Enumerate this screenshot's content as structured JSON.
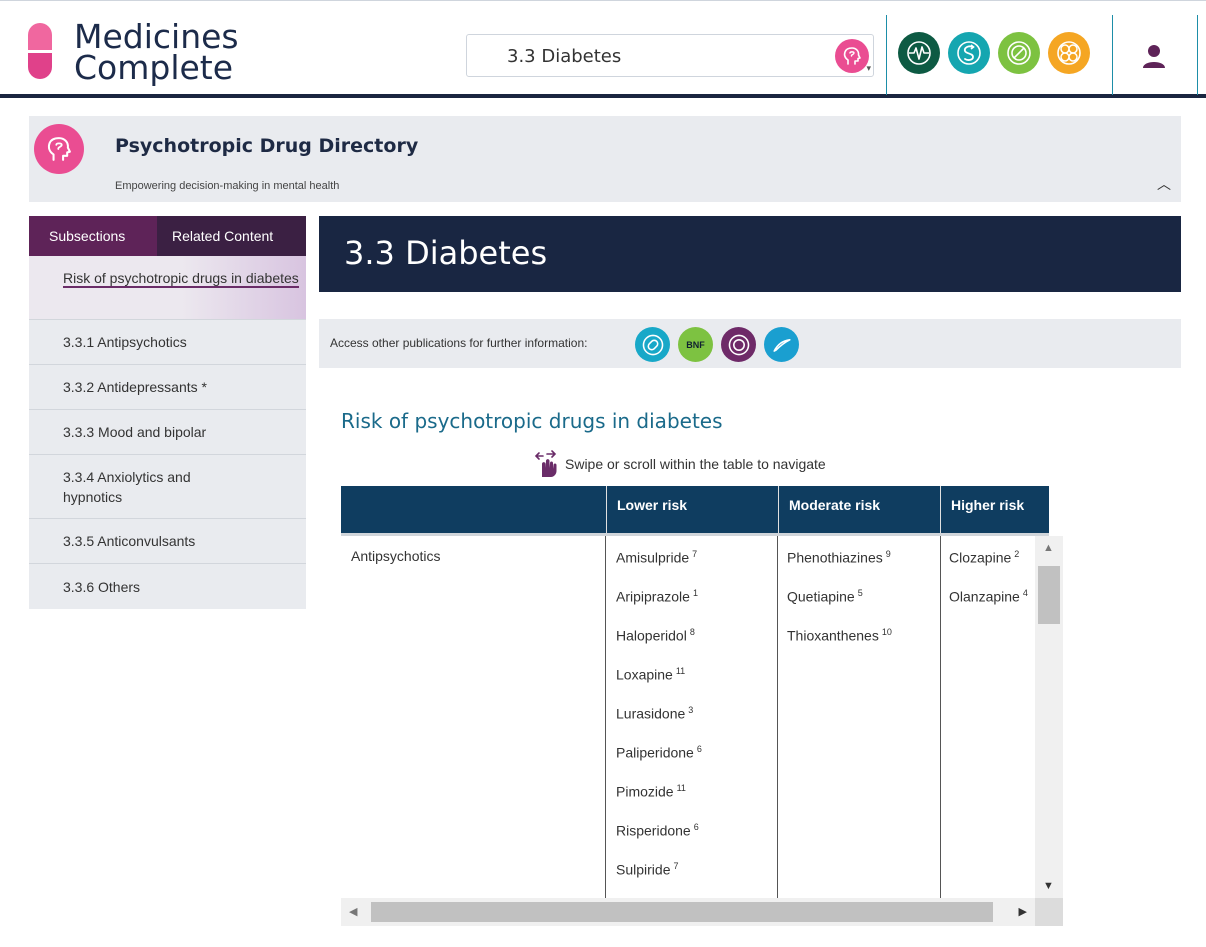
{
  "header": {
    "brand_line1": "Medicines",
    "brand_line2": "Complete",
    "search_value": "3.3 Diabetes",
    "publication_icons": [
      "pulse-icon",
      "cycle-icon",
      "pill-icon",
      "molecule-icon"
    ],
    "accent_colors": {
      "pink": "#ea4d92",
      "green": "#0d5a43",
      "teal": "#15a6b0",
      "lime": "#7dc241",
      "orange": "#f5a623",
      "navy": "#192642",
      "purple": "#5e2358"
    }
  },
  "banner": {
    "title": "Psychotropic Drug Directory",
    "subtitle": "Empowering decision-making in mental health"
  },
  "sidebar": {
    "tabs": [
      "Subsections",
      "Related Content"
    ],
    "items": [
      {
        "label": "Risk of psychotropic drugs in diabetes"
      },
      {
        "label": "3.3.1 Antipsychotics"
      },
      {
        "label": "3.3.2 Antidepressants *"
      },
      {
        "label": "3.3.3 Mood and bipolar"
      },
      {
        "label": "3.3.4 Anxiolytics and hypnotics"
      },
      {
        "label": "3.3.5 Anticonvulsants"
      },
      {
        "label": "3.3.6 Others"
      }
    ]
  },
  "main": {
    "title": "3.3 Diabetes",
    "access_label": "Access other publications for further information:",
    "access_bnf": "BNF",
    "section_heading": "Risk of psychotropic drugs in diabetes",
    "swipe_hint": "Swipe or scroll within the table to navigate"
  },
  "table": {
    "headers": [
      "",
      "Lower risk",
      "Moderate risk",
      "Higher risk"
    ],
    "row_label": "Antipsychotics",
    "lower": [
      {
        "name": "Amisulpride",
        "ref": "7"
      },
      {
        "name": "Aripiprazole",
        "ref": "1"
      },
      {
        "name": "Haloperidol",
        "ref": "8"
      },
      {
        "name": "Loxapine",
        "ref": "11"
      },
      {
        "name": "Lurasidone",
        "ref": "3"
      },
      {
        "name": "Paliperidone",
        "ref": "6"
      },
      {
        "name": "Pimozide",
        "ref": "11"
      },
      {
        "name": "Risperidone",
        "ref": "6"
      },
      {
        "name": "Sulpiride",
        "ref": "7"
      }
    ],
    "moderate": [
      {
        "name": "Phenothiazines",
        "ref": "9"
      },
      {
        "name": "Quetiapine",
        "ref": "5"
      },
      {
        "name": "Thioxanthenes",
        "ref": "10"
      }
    ],
    "higher": [
      {
        "name": "Clozapine",
        "ref": "2"
      },
      {
        "name": "Olanzapine",
        "ref": "4"
      }
    ]
  }
}
